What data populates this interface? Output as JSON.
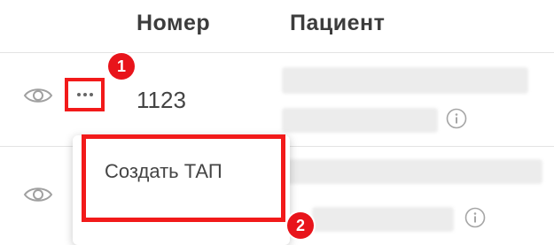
{
  "table": {
    "columns": {
      "number": "Номер",
      "patient": "Пациент"
    },
    "rows": [
      {
        "number": "1123"
      },
      {
        "number": ""
      }
    ]
  },
  "menu": {
    "items": [
      {
        "label": "Создать ТАП"
      }
    ]
  },
  "annotations": {
    "step1": "1",
    "step2": "2"
  },
  "colors": {
    "highlight": "#f21a1a",
    "badge": "#e8141b",
    "icon": "#9a9a9a"
  }
}
